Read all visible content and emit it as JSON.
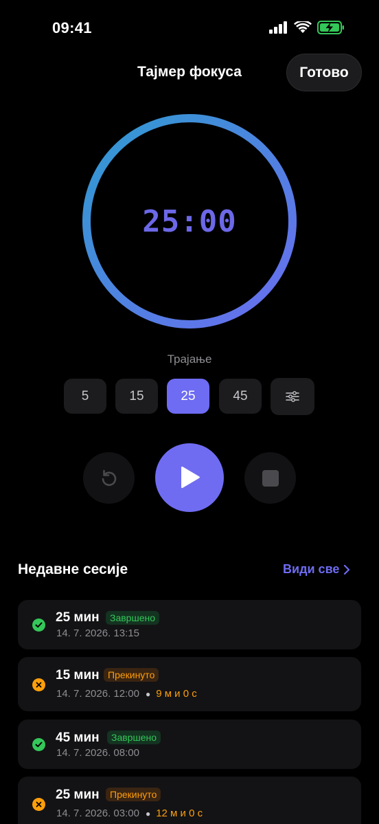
{
  "status_bar": {
    "time": "09:41"
  },
  "header": {
    "title": "Тајмер фокуса",
    "done_label": "Готово"
  },
  "timer": {
    "display": "25:00",
    "progress": 1.0
  },
  "duration": {
    "label": "Трајање",
    "presets": [
      "5",
      "15",
      "25",
      "45"
    ],
    "selected": "25"
  },
  "recent": {
    "title": "Недавне сесије",
    "see_all": "Види све",
    "sessions": [
      {
        "duration": "25 мин",
        "status": "Завршено",
        "state": "done",
        "date": "14. 7. 2026. 13:15",
        "elapsed": ""
      },
      {
        "duration": "15 мин",
        "status": "Прекинуто",
        "state": "interrupted",
        "date": "14. 7. 2026. 12:00",
        "elapsed": "9 м и 0 с"
      },
      {
        "duration": "45 мин",
        "status": "Завршено",
        "state": "done",
        "date": "14. 7. 2026. 08:00",
        "elapsed": ""
      },
      {
        "duration": "25 мин",
        "status": "Прекинуто",
        "state": "interrupted",
        "date": "14. 7. 2026. 03:00",
        "elapsed": "12 м и 0 с"
      }
    ]
  },
  "colors": {
    "accent": "#6e6cf2",
    "ring_start": "#6b6cf0",
    "ring_end": "#2f9bd0",
    "done": "#34c759",
    "interrupted": "#ff9f0a"
  },
  "icons": {
    "signal": "signal-icon",
    "wifi": "wifi-icon",
    "battery": "battery-charging-icon",
    "reset": "reset-icon",
    "play": "play-icon",
    "stop": "stop-icon",
    "sliders": "sliders-icon",
    "chevron": "chevron-right-icon",
    "check": "check-icon",
    "close": "close-icon"
  }
}
